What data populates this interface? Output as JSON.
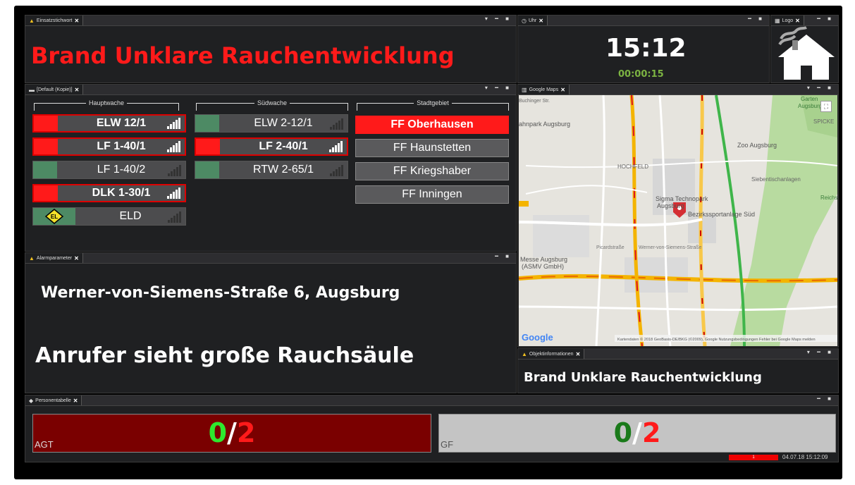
{
  "panels": {
    "einsatz": {
      "tab": "Einsatzstichwort",
      "text": "Brand Unklare Rauchentwicklung"
    },
    "uhr": {
      "tab": "Uhr",
      "time": "15:12",
      "elapsed": "00:00:15"
    },
    "logo": {
      "tab": "Logo"
    },
    "units": {
      "tab": "[Default (Kopie)]"
    },
    "maps": {
      "tab": "Google Maps"
    },
    "alarm": {
      "tab": "Alarmparameter",
      "address": "Werner-von-Siemens-Straße 6,  Augsburg",
      "caller": "Anrufer sieht große Rauchsäule"
    },
    "objekt": {
      "tab": "Objektinformationen",
      "text": "Brand Unklare Rauchentwicklung"
    },
    "personen": {
      "tab": "Personentabelle"
    }
  },
  "groups": [
    {
      "title": "Hauptwache",
      "units": [
        {
          "name": "ELW 12/1",
          "status": "red",
          "alarm": true
        },
        {
          "name": "LF 1-40/1",
          "status": "red",
          "alarm": true
        },
        {
          "name": "LF 1-40/2",
          "status": "green",
          "alarm": false
        },
        {
          "name": "DLK 1-30/1",
          "status": "red",
          "alarm": true
        },
        {
          "name": "ELD",
          "status": "green",
          "alarm": false,
          "badge": "EL"
        }
      ]
    },
    {
      "title": "Südwache",
      "units": [
        {
          "name": "ELW 2-12/1",
          "status": "green",
          "alarm": false
        },
        {
          "name": "LF 2-40/1",
          "status": "red",
          "alarm": true
        },
        {
          "name": "RTW 2-65/1",
          "status": "green",
          "alarm": false
        }
      ]
    },
    {
      "title": "Stadtgebiet",
      "units": [
        {
          "name": "FF Oberhausen",
          "alarm": true
        },
        {
          "name": "FF Haunstetten",
          "alarm": false
        },
        {
          "name": "FF Kriegshaber",
          "alarm": false
        },
        {
          "name": "FF Inningen",
          "alarm": false
        }
      ]
    }
  ],
  "map": {
    "labels": {
      "buchinger": "Buchinger Str.",
      "garten": "Garten",
      "augsburg": "Augsburg",
      "spicke": "SPICKE",
      "bahnpark": "ahnpark Augsburg",
      "zoo": "Zoo Augsburg",
      "hochfeld": "HOCHFELD",
      "sieben": "Siebentischanlagen",
      "reichs": "Reichs",
      "sigma": "Sigma Technopark",
      "augsb2": "Augsburg",
      "bezirk": "Bezirkssportanlage Süd",
      "wvs": "Werner-von-Siemens-Straße",
      "picard": "Picardstraße",
      "messe": "Messe Augsburg",
      "asmv": "(ASMV GmbH)",
      "google": "Google",
      "copyright": "Kartendaten © 2018 GeoBasis-DE/BKG (©2009), Google   Nutzungsbedingungen   Fehler bei Google Maps melden"
    }
  },
  "persons": [
    {
      "label": "AGT",
      "present": "0",
      "sep": "/",
      "total": "2"
    },
    {
      "label": "GF",
      "present": "0",
      "sep": "/",
      "total": "2"
    }
  ],
  "footer": {
    "timestamp": "04.07.18 15:12:09",
    "alarm_count": "1"
  },
  "colors": {
    "red": "#ff1a1a",
    "green": "#4d8a64",
    "dark": "#1f2022"
  }
}
